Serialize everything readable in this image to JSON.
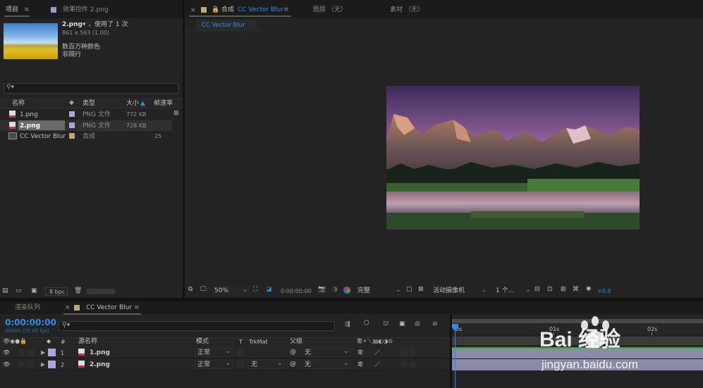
{
  "project_panel": {
    "tab_project": "项目",
    "tab_effects": "效果控件 2.png",
    "preview": {
      "name": "2.png",
      "used": "，使用了 1 次",
      "dims": "861 x 563 (1.00)",
      "color": "数百万种颜色",
      "interlace": "非隔行"
    },
    "columns": [
      "名称",
      "类型",
      "大小",
      "帧速率"
    ],
    "items": [
      {
        "name": "1.png",
        "type": "PNG 文件",
        "size": "772 KB",
        "fps": ""
      },
      {
        "name": "2.png",
        "type": "PNG 文件",
        "size": "728 KB",
        "fps": ""
      },
      {
        "name": "CC Vector Blur",
        "type": "合成",
        "size": "",
        "fps": "25"
      }
    ],
    "bpc": "8 bpc"
  },
  "comp_panel": {
    "tab_comp_prefix": "合成",
    "tab_comp_name": "CC Vector Blur",
    "tab_layer": "图层 （无）",
    "tab_footage": "素材 （无）",
    "subtab": "CC Vector Blur",
    "zoom": "50%",
    "timecode": "0:00:00:00",
    "resolution": "完整",
    "camera": "活动摄像机",
    "views": "1 个...",
    "exposure": "+0.0"
  },
  "timeline": {
    "tab_render": "渲染队列",
    "tab_comp": "CC Vector Blur",
    "timecode": "0:00:00:00",
    "frames": "00000 (25.00 fps)",
    "col_num": "#",
    "col_source": "源名称",
    "col_mode": "模式",
    "col_t": "T",
    "col_trkmat": "TrkMat",
    "col_parent": "父级",
    "ruler": [
      "0s",
      "01s",
      "02s"
    ],
    "layers": [
      {
        "num": "1",
        "name": "1.png",
        "mode": "正常",
        "trkmat": "",
        "parent": "无"
      },
      {
        "num": "2",
        "name": "2.png",
        "mode": "正常",
        "trkmat": "无",
        "parent": "无"
      }
    ]
  },
  "watermark": {
    "brand": "Bai 经验",
    "url": "jingyan.baidu.com"
  }
}
